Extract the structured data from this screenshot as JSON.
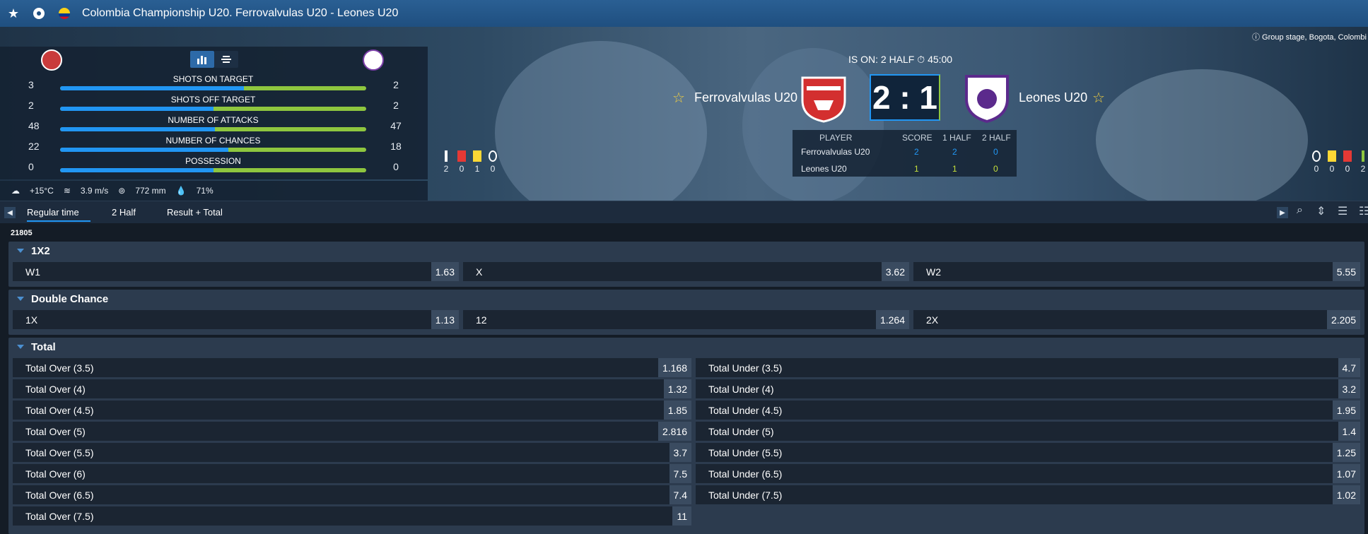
{
  "header": {
    "title": "Colombia Championship U20. Ferrovalvulas U20 - Leones U20"
  },
  "location": "Group stage, Bogota, Colombi",
  "stats": [
    {
      "label": "SHOTS ON TARGET",
      "left": "3",
      "right": "2",
      "share": 0.6
    },
    {
      "label": "SHOTS OFF TARGET",
      "left": "2",
      "right": "2",
      "share": 0.5
    },
    {
      "label": "NUMBER OF ATTACKS",
      "left": "48",
      "right": "47",
      "share": 0.505
    },
    {
      "label": "NUMBER OF CHANCES",
      "left": "22",
      "right": "18",
      "share": 0.55
    },
    {
      "label": "POSSESSION",
      "left": "0",
      "right": "0",
      "share": 0.5
    }
  ],
  "weather": {
    "temp": "+15°C",
    "wind": "3.9 m/s",
    "pressure": "772 mm",
    "humidity": "71%"
  },
  "match": {
    "status": "IS ON: 2  HALF",
    "time": "45:00",
    "home": "Ferrovalvulas U20",
    "away": "Leones U20",
    "score": "2 : 1"
  },
  "score_table": {
    "headers": [
      "PLAYER",
      "SCORE",
      "1 HALF",
      "2 HALF"
    ],
    "rows": [
      {
        "team": "Ferrovalvulas U20",
        "score": "2",
        "h1": "2",
        "h2": "0"
      },
      {
        "team": "Leones U20",
        "score": "1",
        "h1": "1",
        "h2": "0"
      }
    ]
  },
  "home_cards": [
    "2",
    "0",
    "1",
    "0"
  ],
  "away_cards": [
    "0",
    "0",
    "0",
    "2"
  ],
  "tabs": [
    "Regular time",
    "2  Half",
    "Result + Total"
  ],
  "game_id": "21805",
  "markets": {
    "m1x2": {
      "title": "1X2",
      "items": [
        {
          "label": "W1",
          "odd": "1.63"
        },
        {
          "label": "X",
          "odd": "3.62"
        },
        {
          "label": "W2",
          "odd": "5.55"
        }
      ]
    },
    "double": {
      "title": "Double Chance",
      "items": [
        {
          "label": "1X",
          "odd": "1.13"
        },
        {
          "label": "12",
          "odd": "1.264"
        },
        {
          "label": "2X",
          "odd": "2.205"
        }
      ]
    },
    "total": {
      "title": "Total",
      "over": [
        {
          "label": "Total Over (3.5)",
          "odd": "1.168"
        },
        {
          "label": "Total Over (4)",
          "odd": "1.32"
        },
        {
          "label": "Total Over (4.5)",
          "odd": "1.85"
        },
        {
          "label": "Total Over (5)",
          "odd": "2.816"
        },
        {
          "label": "Total Over (5.5)",
          "odd": "3.7"
        },
        {
          "label": "Total Over (6)",
          "odd": "7.5"
        },
        {
          "label": "Total Over (6.5)",
          "odd": "7.4"
        },
        {
          "label": "Total Over (7.5)",
          "odd": "11"
        }
      ],
      "under": [
        {
          "label": "Total Under (3.5)",
          "odd": "4.7"
        },
        {
          "label": "Total Under (4)",
          "odd": "3.2"
        },
        {
          "label": "Total Under (4.5)",
          "odd": "1.95"
        },
        {
          "label": "Total Under (5)",
          "odd": "1.4"
        },
        {
          "label": "Total Under (5.5)",
          "odd": "1.25"
        },
        {
          "label": "Total Under (6.5)",
          "odd": "1.07"
        },
        {
          "label": "Total Under (7.5)",
          "odd": "1.02"
        }
      ]
    }
  },
  "colors": {
    "home": "#2196f3",
    "away": "#8ec63f",
    "accent": "#2d6aa8"
  }
}
